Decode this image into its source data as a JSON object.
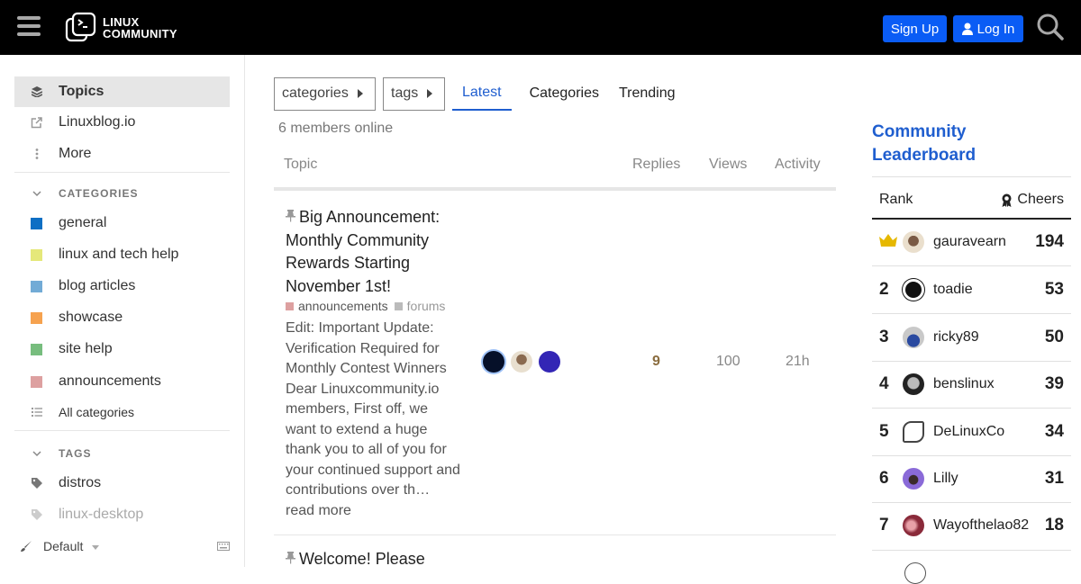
{
  "header": {
    "logo_line1": "LINUX",
    "logo_line2": "COMMUNITY",
    "signup_label": "Sign Up",
    "login_label": "Log In",
    "accent": "#0a5cf5"
  },
  "sidebar": {
    "items": [
      {
        "label": "Topics",
        "icon": "layers-icon"
      },
      {
        "label": "Linuxblog.io",
        "icon": "external-link-icon"
      },
      {
        "label": "More",
        "icon": "ellipsis-vertical-icon"
      }
    ],
    "categories_heading": "CATEGORIES",
    "categories": [
      {
        "label": "general",
        "color": "#0e6fc4"
      },
      {
        "label": "linux and tech help",
        "color": "#e5e87a"
      },
      {
        "label": "blog articles",
        "color": "#72abd6"
      },
      {
        "label": "showcase",
        "color": "#f6a24f"
      },
      {
        "label": "site help",
        "color": "#77bd7e"
      },
      {
        "label": "announcements",
        "color": "#dda0a0"
      }
    ],
    "all_categories_label": "All categories",
    "tags_heading": "TAGS",
    "tags": [
      {
        "label": "distros"
      },
      {
        "label": "linux-desktop"
      }
    ],
    "theme_label": "Default"
  },
  "nav": {
    "categories_dropdown": "categories",
    "tags_dropdown": "tags",
    "tabs": [
      {
        "label": "Latest",
        "active": true
      },
      {
        "label": "Categories",
        "active": false
      },
      {
        "label": "Trending",
        "active": false
      }
    ]
  },
  "online_text": "6 members online",
  "table": {
    "headers": {
      "topic": "Topic",
      "replies": "Replies",
      "views": "Views",
      "activity": "Activity"
    },
    "topics": [
      {
        "title": "Big Announcement: Monthly Community Rewards Starting November 1st!",
        "pinned": true,
        "category": {
          "label": "announcements",
          "color": "#dda0a0"
        },
        "tag": "forums",
        "excerpt": "Edit: Important Update: Verification Required for Monthly Contest Winners Dear Linuxcommunity.io members, First off, we want to extend a huge thank you to all of you for your continued support and contributions over th…",
        "read_more": "read more",
        "replies": "9",
        "views": "100",
        "activity": "21h"
      },
      {
        "title": "Welcome! Please",
        "pinned": true
      }
    ]
  },
  "leaderboard": {
    "title": "Community Leaderboard",
    "rank_header": "Rank",
    "cheers_header": "Cheers",
    "rows": [
      {
        "rank": "1",
        "name": "gauravearn",
        "score": "194",
        "crown": true
      },
      {
        "rank": "2",
        "name": "toadie",
        "score": "53"
      },
      {
        "rank": "3",
        "name": "ricky89",
        "score": "50"
      },
      {
        "rank": "4",
        "name": "benslinux",
        "score": "39"
      },
      {
        "rank": "5",
        "name": "DeLinuxCo",
        "score": "34"
      },
      {
        "rank": "6",
        "name": "Lilly",
        "score": "31"
      },
      {
        "rank": "7",
        "name": "Wayofthelao82",
        "score": "18"
      }
    ]
  }
}
